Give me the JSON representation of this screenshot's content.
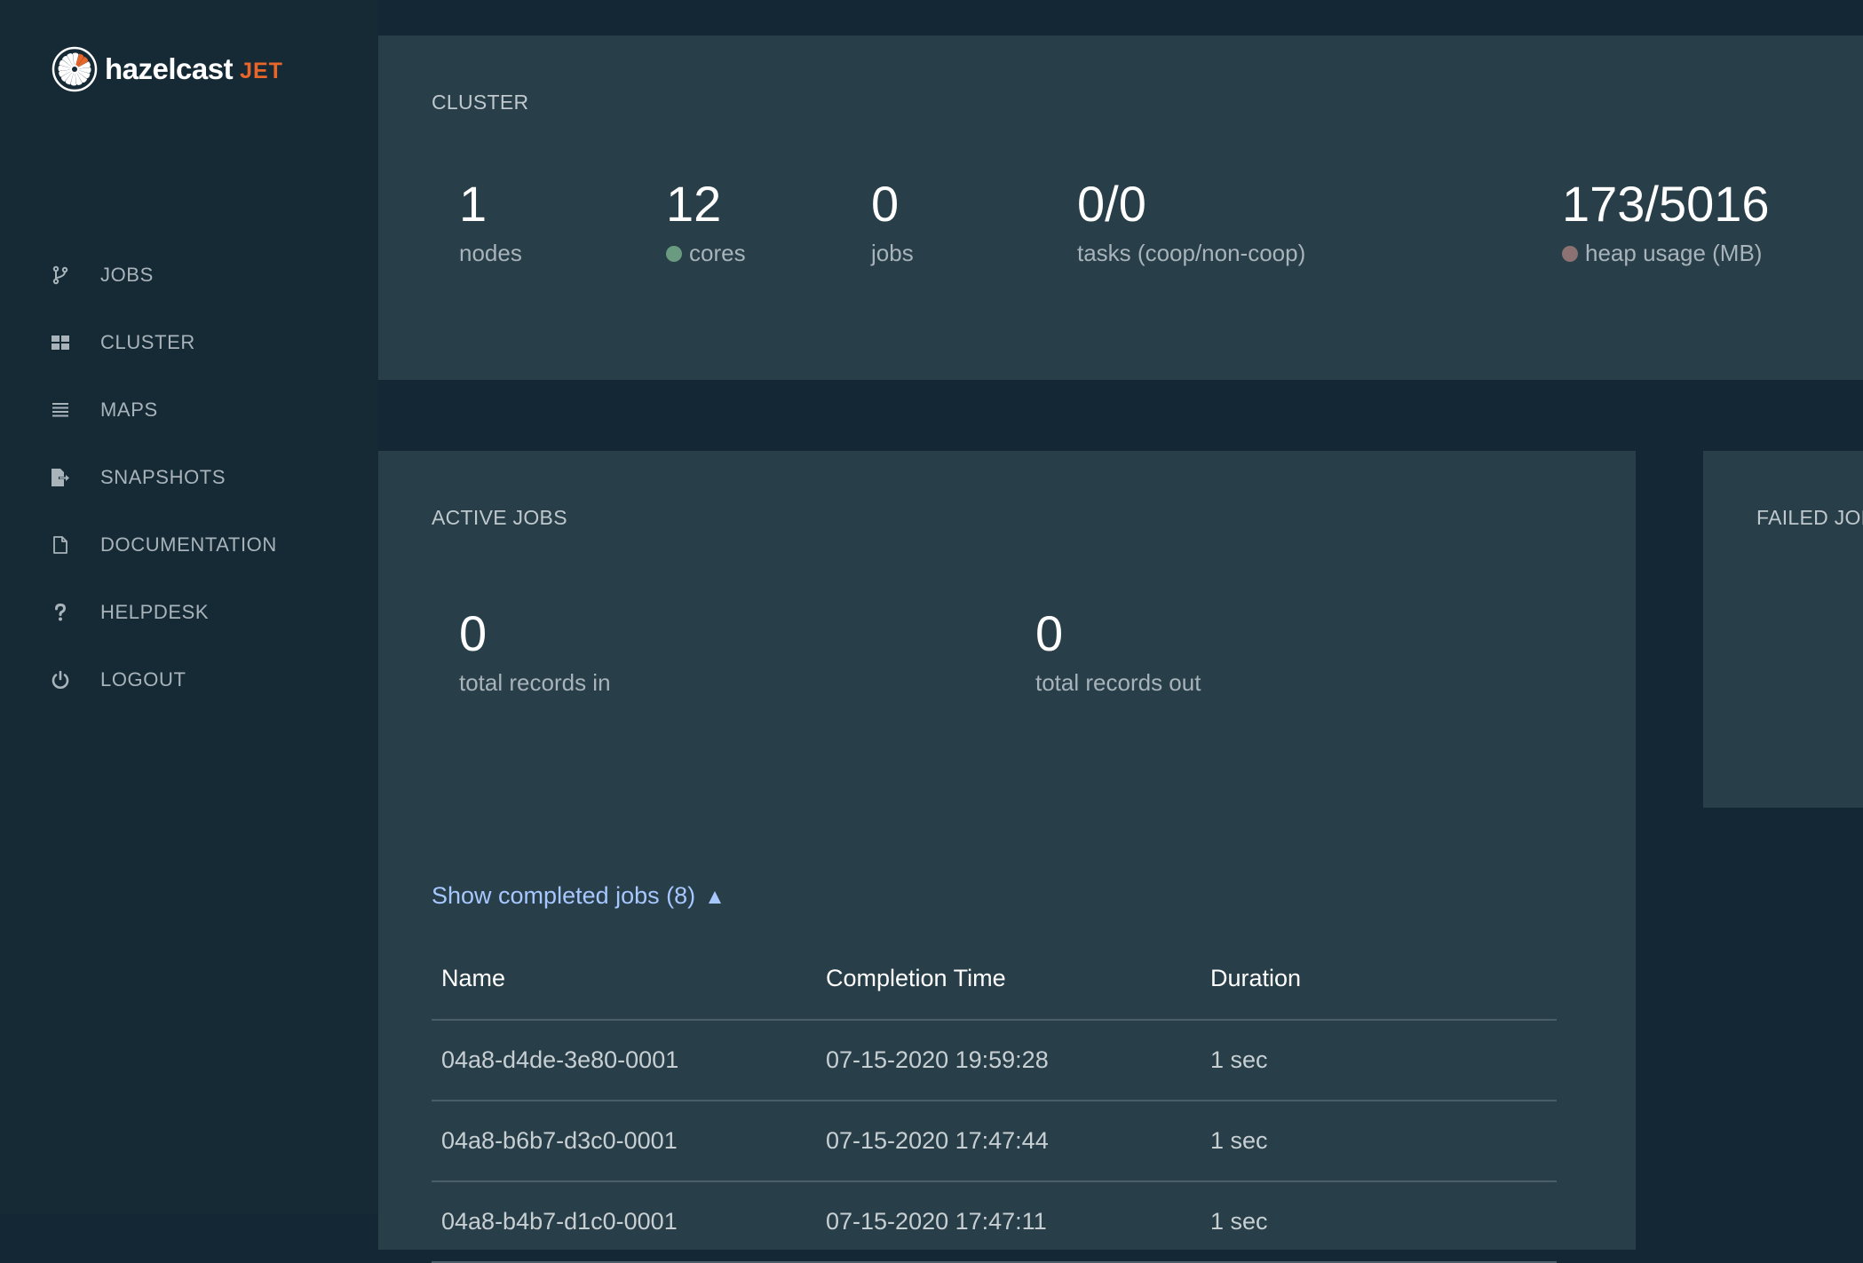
{
  "brand": {
    "name": "hazelcast",
    "product": "JET",
    "accent_color": "#e8662a"
  },
  "sidebar": {
    "items": [
      {
        "label": "JOBS",
        "icon": "branch-icon"
      },
      {
        "label": "CLUSTER",
        "icon": "grid-icon"
      },
      {
        "label": "MAPS",
        "icon": "list-icon"
      },
      {
        "label": "SNAPSHOTS",
        "icon": "file-export-icon"
      },
      {
        "label": "DOCUMENTATION",
        "icon": "document-icon"
      },
      {
        "label": "HELPDESK",
        "icon": "question-icon"
      },
      {
        "label": "LOGOUT",
        "icon": "power-icon"
      }
    ]
  },
  "cluster": {
    "title": "CLUSTER",
    "stats": [
      {
        "value": "1",
        "label": "nodes"
      },
      {
        "value": "12",
        "label": "cores",
        "dot_color": "#6a9a80"
      },
      {
        "value": "0",
        "label": "jobs"
      },
      {
        "value": "0/0",
        "label": "tasks (coop/non-coop)"
      },
      {
        "value": "173/5016",
        "label": "heap usage (MB)",
        "dot_color": "#8c7272"
      }
    ]
  },
  "active_jobs": {
    "title": "ACTIVE JOBS",
    "stats": [
      {
        "value": "0",
        "label": "total records in"
      },
      {
        "value": "0",
        "label": "total records out"
      }
    ],
    "toggle_label": "Show completed jobs (8)",
    "toggle_arrow": "▲",
    "link_color": "#a7c7ff",
    "table": {
      "columns": [
        "Name",
        "Completion Time",
        "Duration"
      ],
      "rows": [
        {
          "name": "04a8-d4de-3e80-0001",
          "completion_time": "07-15-2020 19:59:28",
          "duration": "1 sec"
        },
        {
          "name": "04a8-b6b7-d3c0-0001",
          "completion_time": "07-15-2020 17:47:44",
          "duration": "1 sec"
        },
        {
          "name": "04a8-b4b7-d1c0-0001",
          "completion_time": "07-15-2020 17:47:11",
          "duration": "1 sec"
        }
      ]
    }
  },
  "failed_jobs": {
    "title": "FAILED JOBS"
  }
}
